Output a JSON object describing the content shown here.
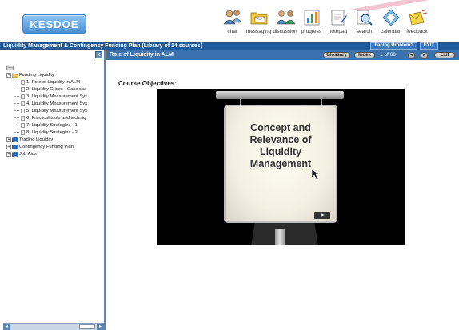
{
  "header": {
    "logo_text": "KESDOE",
    "toolbar": [
      {
        "label": "chat",
        "icon": "chat-icon"
      },
      {
        "label": "messaging",
        "icon": "messaging-icon"
      },
      {
        "label": "discussion",
        "icon": "discussion-icon"
      },
      {
        "label": "progress",
        "icon": "progress-icon"
      },
      {
        "label": "notepad",
        "icon": "notepad-icon"
      },
      {
        "label": "search",
        "icon": "search-icon"
      },
      {
        "label": "calendar",
        "icon": "calendar-icon"
      },
      {
        "label": "feedback",
        "icon": "feedback-icon"
      }
    ]
  },
  "titlebar": {
    "title": "Liquidity Management & Contingency Funding Plan (Library of 14 courses)",
    "facing_problem": "Facing Problem?",
    "exit": "EXIT"
  },
  "sidebar": {
    "collapse_label": "x",
    "tree": [
      {
        "label": "Funding Liquidity",
        "expanded": true,
        "children": [
          "1. Role of Liquidity in ALM",
          "2. Liquidity Crises - Case stu",
          "3. Liquidity Measurement Sys",
          "4. Liquidity Measurement Sys",
          "5. Liquidity Measurement Sys",
          "6. Practical tools and techniq",
          "7. Liquidity Strategies - 1",
          "8. Liquidity Strategies - 2"
        ]
      },
      {
        "label": "Trading Liquidity",
        "expanded": false,
        "children": []
      },
      {
        "label": "Contingency Funding Plan",
        "expanded": false,
        "children": []
      },
      {
        "label": "Job Aids",
        "expanded": false,
        "children": []
      }
    ]
  },
  "main": {
    "lesson_title": "Role of Liquidity in ALM",
    "glossary": "Glossary",
    "index": "Index",
    "page_count": "1 of 66",
    "exit": "Exit",
    "objectives_heading": "Course Objectives:",
    "video_text": "Concept and Relevance of Liquidity Management"
  },
  "colors": {
    "title_bar": "#1f5a9a",
    "main_bar": "#3a72b0",
    "accent": "#5a86b8"
  }
}
